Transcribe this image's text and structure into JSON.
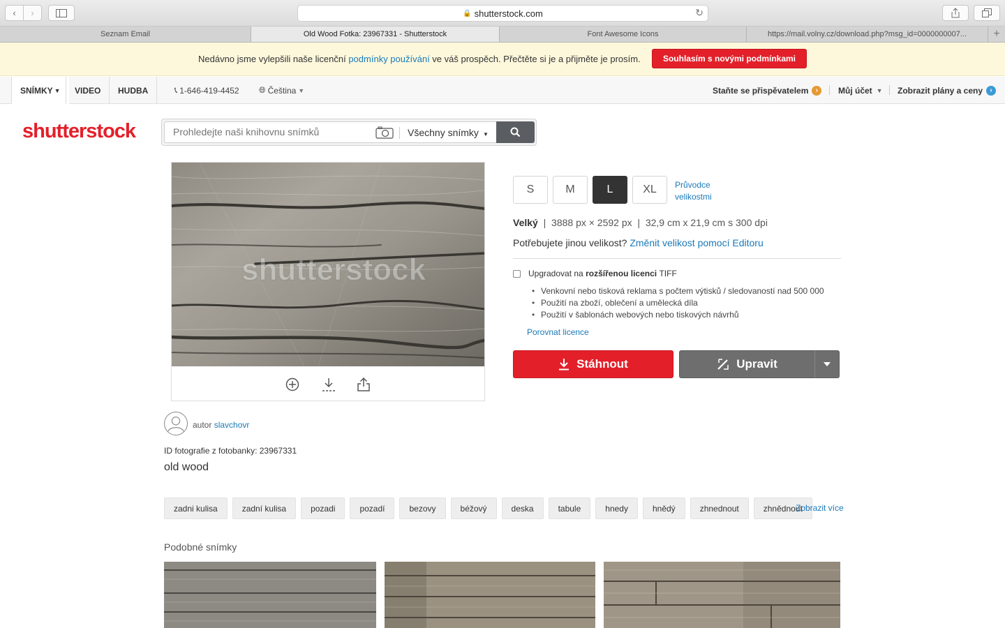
{
  "browser": {
    "url": "shutterstock.com",
    "tabs": [
      {
        "label": "Seznam Email",
        "active": false
      },
      {
        "label": "Old Wood Fotka: 23967331 - Shutterstock",
        "active": true
      },
      {
        "label": "Font Awesome Icons",
        "active": false
      },
      {
        "label": "https://mail.volny.cz/download.php?msg_id=0000000007...",
        "active": false
      }
    ]
  },
  "notice": {
    "text_before": "Nedávno jsme vylepšili naše licenční ",
    "link": "podmínky používání",
    "text_after": " ve váš prospěch. Přečtěte si je a přijměte je prosím.",
    "button": "Souhlasím s novými podmínkami"
  },
  "nav": {
    "tabs": [
      "SNÍMKY",
      "VIDEO",
      "HUDBA"
    ],
    "phone": "1-646-419-4452",
    "language": "Čeština",
    "contributor": "Staňte se přispěvatelem",
    "account": "Můj účet",
    "plans": "Zobrazit plány a ceny"
  },
  "logo": "shutterstock",
  "search": {
    "placeholder": "Prohledejte naši knihovnu snímků",
    "type": "Všechny snímky"
  },
  "image": {
    "watermark": "shutterstock"
  },
  "author": {
    "prefix": "autor",
    "name": "slavchovr"
  },
  "photo": {
    "id_label": "ID fotografie z fotobanky: 23967331",
    "title": "old wood"
  },
  "sizes": [
    "S",
    "M",
    "L",
    "XL"
  ],
  "selected_size": "L",
  "size_guide": "Průvodce velikostmi",
  "size_info": {
    "name": "Velký",
    "px": "3888 px × 2592 px",
    "cm": "32,9 cm x 21,9 cm s 300 dpi"
  },
  "need_size": {
    "text": "Potřebujete jinou velikost?",
    "link": "Změnit velikost pomocí Editoru"
  },
  "upgrade": {
    "prefix": "Upgradovat na",
    "bold": "rozšířenou licenci",
    "suffix": "TIFF",
    "bullets": [
      "Venkovní nebo tisková reklama s počtem výtisků / sledovaností nad 500 000",
      "Použití na zboží, oblečení a umělecká díla",
      "Použití v šablonách webových nebo tiskových návrhů"
    ],
    "compare": "Porovnat licence"
  },
  "buttons": {
    "download": "Stáhnout",
    "edit": "Upravit"
  },
  "tags": [
    "zadni kulisa",
    "zadní kulisa",
    "pozadi",
    "pozadí",
    "bezovy",
    "béžový",
    "deska",
    "tabule",
    "hnedy",
    "hnědý",
    "zhnednout",
    "zhnědnout"
  ],
  "more_tags": "Zobrazit více",
  "similar": "Podobné snímky",
  "colors": {
    "brand_red": "#e3202a",
    "link_blue": "#1a79b9",
    "edit_gray": "#6e6e6e"
  }
}
